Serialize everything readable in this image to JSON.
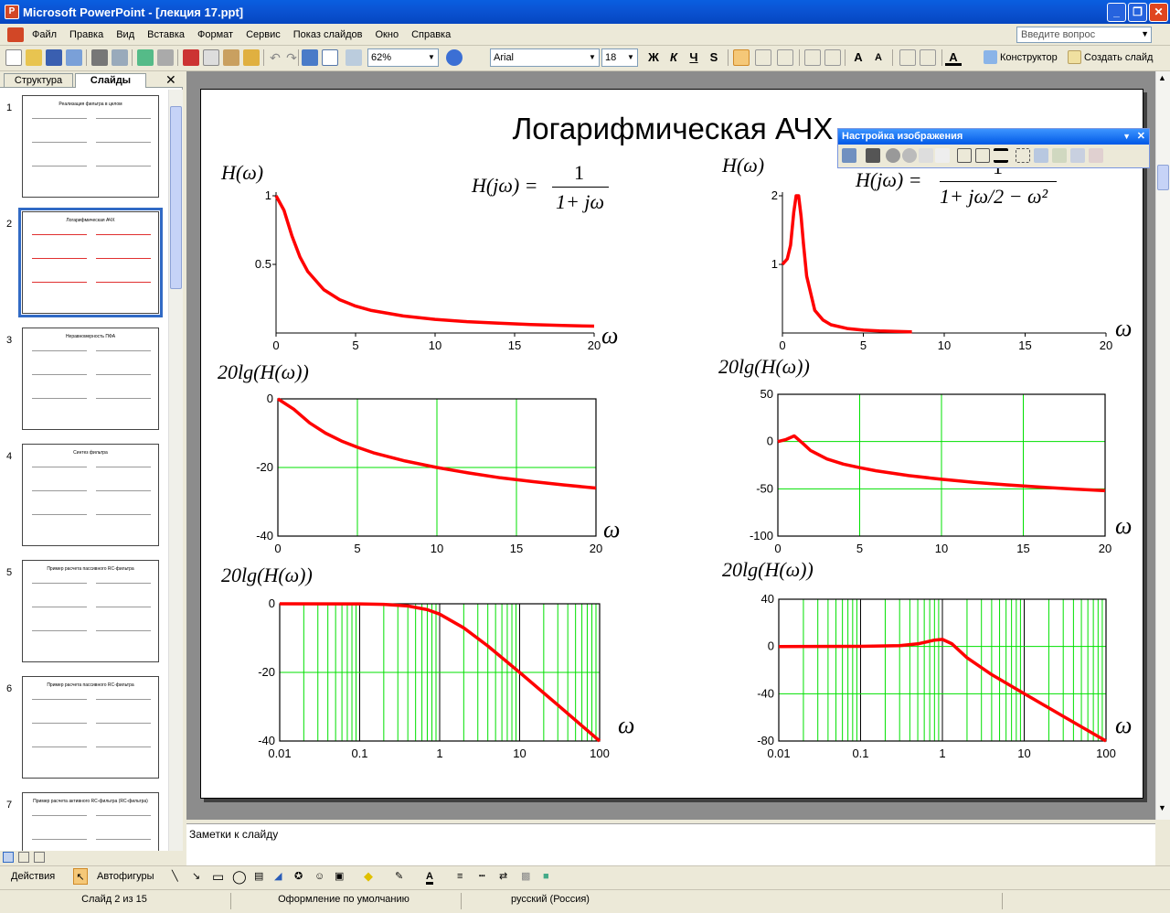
{
  "window": {
    "title": "Microsoft PowerPoint - [лекция 17.ppt]"
  },
  "menu": [
    "Файл",
    "Правка",
    "Вид",
    "Вставка",
    "Формат",
    "Сервис",
    "Показ слайдов",
    "Окно",
    "Справка"
  ],
  "help_placeholder": "Введите вопрос",
  "toolbar": {
    "zoom": "62%",
    "font": "Arial",
    "font_size": "18",
    "bold": "Ж",
    "italic": "К",
    "underline": "Ч",
    "shadow": "S",
    "design_label": "Конструктор",
    "new_slide_label": "Создать слайд"
  },
  "left_pane": {
    "tab_outline": "Структура",
    "tab_slides": "Слайды",
    "selected_index": 2,
    "slides": [
      {
        "num": "1",
        "title": "Реализация фильтра в целом"
      },
      {
        "num": "2",
        "title": "Логарифмическая АЧХ"
      },
      {
        "num": "3",
        "title": "Неравномерность ПФА"
      },
      {
        "num": "4",
        "title": "Синтез фильтра"
      },
      {
        "num": "5",
        "title": "Пример расчета пассивного RC-фильтра"
      },
      {
        "num": "6",
        "title": "Пример расчета пассивного RC-фильтра"
      },
      {
        "num": "7",
        "title": "Пример расчета активного RC-фильтра (RC-фильтра)"
      }
    ]
  },
  "picture_toolbar": {
    "title": "Настройка изображения"
  },
  "slide": {
    "title": "Логарифмическая АЧХ",
    "labels": {
      "H": "H(ω)",
      "db": "20lg(H(ω))",
      "omega": "ω"
    },
    "formula_left": {
      "lhs": "H(jω) =",
      "num": "1",
      "den": "1+ jω"
    },
    "formula_right": {
      "lhs": "H(jω) =",
      "num": "1",
      "den": "1+ jω/2 − ω²"
    }
  },
  "chart_data": [
    {
      "type": "line",
      "id": "first-order-magnitude",
      "xlim": [
        0,
        20
      ],
      "ylim": [
        0,
        1
      ],
      "xticks": [
        "0",
        "5",
        "10",
        "15",
        "20"
      ],
      "yticks": [
        "0.5",
        "1"
      ],
      "grid": false,
      "series": [
        {
          "x": [
            0,
            0.5,
            1,
            1.5,
            2,
            3,
            4,
            5,
            6,
            8,
            10,
            12,
            14,
            16,
            18,
            20
          ],
          "y": [
            1,
            0.894,
            0.707,
            0.555,
            0.447,
            0.316,
            0.243,
            0.196,
            0.164,
            0.124,
            0.0995,
            0.083,
            0.071,
            0.062,
            0.055,
            0.05
          ]
        }
      ]
    },
    {
      "type": "line",
      "id": "second-order-magnitude",
      "xlim": [
        0,
        20
      ],
      "ylim": [
        0,
        2
      ],
      "xticks": [
        "0",
        "5",
        "10",
        "15",
        "20"
      ],
      "yticks": [
        "1",
        "2"
      ],
      "grid": false,
      "series": [
        {
          "x": [
            0,
            0.3,
            0.5,
            0.7,
            0.85,
            1,
            1.15,
            1.3,
            1.5,
            2,
            2.5,
            3,
            4,
            5,
            6,
            8
          ],
          "y": [
            1,
            1.08,
            1.28,
            1.76,
            2,
            2,
            1.7,
            1.3,
            0.83,
            0.33,
            0.19,
            0.12,
            0.066,
            0.042,
            0.029,
            0.016
          ]
        }
      ]
    },
    {
      "type": "line",
      "id": "first-order-db-linear",
      "xlim": [
        0,
        20
      ],
      "ylim": [
        -40,
        0
      ],
      "xticks": [
        "0",
        "5",
        "10",
        "15",
        "20"
      ],
      "yticks": [
        "-40",
        "-20",
        "0"
      ],
      "grid": true,
      "series": [
        {
          "x": [
            0,
            1,
            2,
            3,
            4,
            5,
            6,
            8,
            10,
            12,
            14,
            16,
            18,
            20
          ],
          "y": [
            0,
            -3.0,
            -7.0,
            -10.0,
            -12.3,
            -14.1,
            -15.7,
            -18.1,
            -20.0,
            -21.6,
            -23.0,
            -24.1,
            -25.1,
            -26.0
          ]
        }
      ]
    },
    {
      "type": "line",
      "id": "second-order-db-linear",
      "xlim": [
        0,
        20
      ],
      "ylim": [
        -100,
        50
      ],
      "xticks": [
        "0",
        "5",
        "10",
        "15",
        "20"
      ],
      "yticks": [
        "-100",
        "-50",
        "0",
        "50"
      ],
      "grid": true,
      "series": [
        {
          "x": [
            0,
            0.5,
            1,
            1.5,
            2,
            3,
            4,
            5,
            6,
            8,
            10,
            12,
            14,
            16,
            18,
            20
          ],
          "y": [
            0,
            2.2,
            6.0,
            -1.6,
            -9.5,
            -18.4,
            -23.8,
            -27.6,
            -30.9,
            -36.0,
            -39.9,
            -43.1,
            -45.8,
            -48.1,
            -50.2,
            -52.0
          ]
        }
      ]
    },
    {
      "type": "line",
      "id": "first-order-bode",
      "xscale": "log",
      "xlim": [
        0.01,
        100
      ],
      "ylim": [
        -40,
        0
      ],
      "xticks": [
        "0.01",
        "0.1",
        "1",
        "10",
        "100"
      ],
      "yticks": [
        "-40",
        "-20",
        "0"
      ],
      "grid": true,
      "series": [
        {
          "x": [
            0.01,
            0.1,
            0.2,
            0.4,
            0.7,
            1,
            2,
            4,
            10,
            30,
            100
          ],
          "y": [
            0,
            -0.04,
            -0.17,
            -0.65,
            -1.7,
            -3.0,
            -7.0,
            -12.3,
            -20.0,
            -29.5,
            -40.0
          ]
        }
      ]
    },
    {
      "type": "line",
      "id": "second-order-bode",
      "xscale": "log",
      "xlim": [
        0.01,
        100
      ],
      "ylim": [
        -80,
        40
      ],
      "xticks": [
        "0.01",
        "0.1",
        "1",
        "10",
        "100"
      ],
      "yticks": [
        "-80",
        "-40",
        "0",
        "40"
      ],
      "grid": true,
      "series": [
        {
          "x": [
            0.01,
            0.1,
            0.3,
            0.5,
            0.8,
            1,
            1.3,
            2,
            4,
            10,
            30,
            100
          ],
          "y": [
            0,
            0.1,
            0.7,
            2.2,
            5.4,
            6.0,
            2.4,
            -9.5,
            -23.8,
            -39.9,
            -59.1,
            -80.0
          ]
        }
      ]
    }
  ],
  "notes_placeholder": "Заметки к слайду",
  "drawing": {
    "actions": "Действия",
    "autoshapes": "Автофигуры"
  },
  "status": {
    "slide": "Слайд 2 из 15",
    "design": "Оформление по умолчанию",
    "lang": "русский (Россия)"
  },
  "colors": {
    "curve": "#ff0000",
    "grid": "#00e000",
    "title_bar": "#0a5fe0",
    "selection": "#316ac5"
  }
}
